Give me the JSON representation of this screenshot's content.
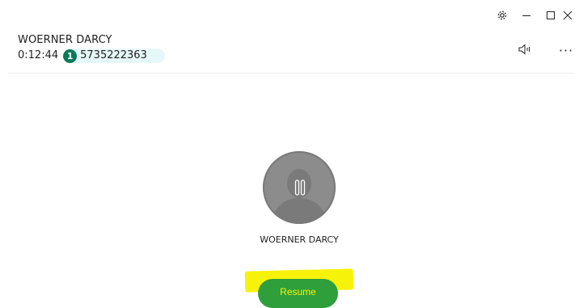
{
  "window": {
    "controls": {
      "settings_icon": "gear-icon",
      "minimize_label": "–",
      "maximize_icon": "maximize-icon",
      "close_icon": "close-icon"
    }
  },
  "call": {
    "caller_name": "WOERNER DARCY",
    "timer": "0:12:44",
    "line_number": "1",
    "phone_number": "5735222363",
    "colors": {
      "line_badge": "#0a7a5a",
      "line_pill": "#e6f7fa"
    }
  },
  "actions": {
    "speaker_icon": "speaker-icon",
    "more_label": "···"
  },
  "avatar": {
    "name": "WOERNER DARCY",
    "status_icon": "pause-icon"
  },
  "primary_action": {
    "resume_label": "Resume",
    "color": "#2e9f3a",
    "highlight_color": "#f7f20a"
  }
}
